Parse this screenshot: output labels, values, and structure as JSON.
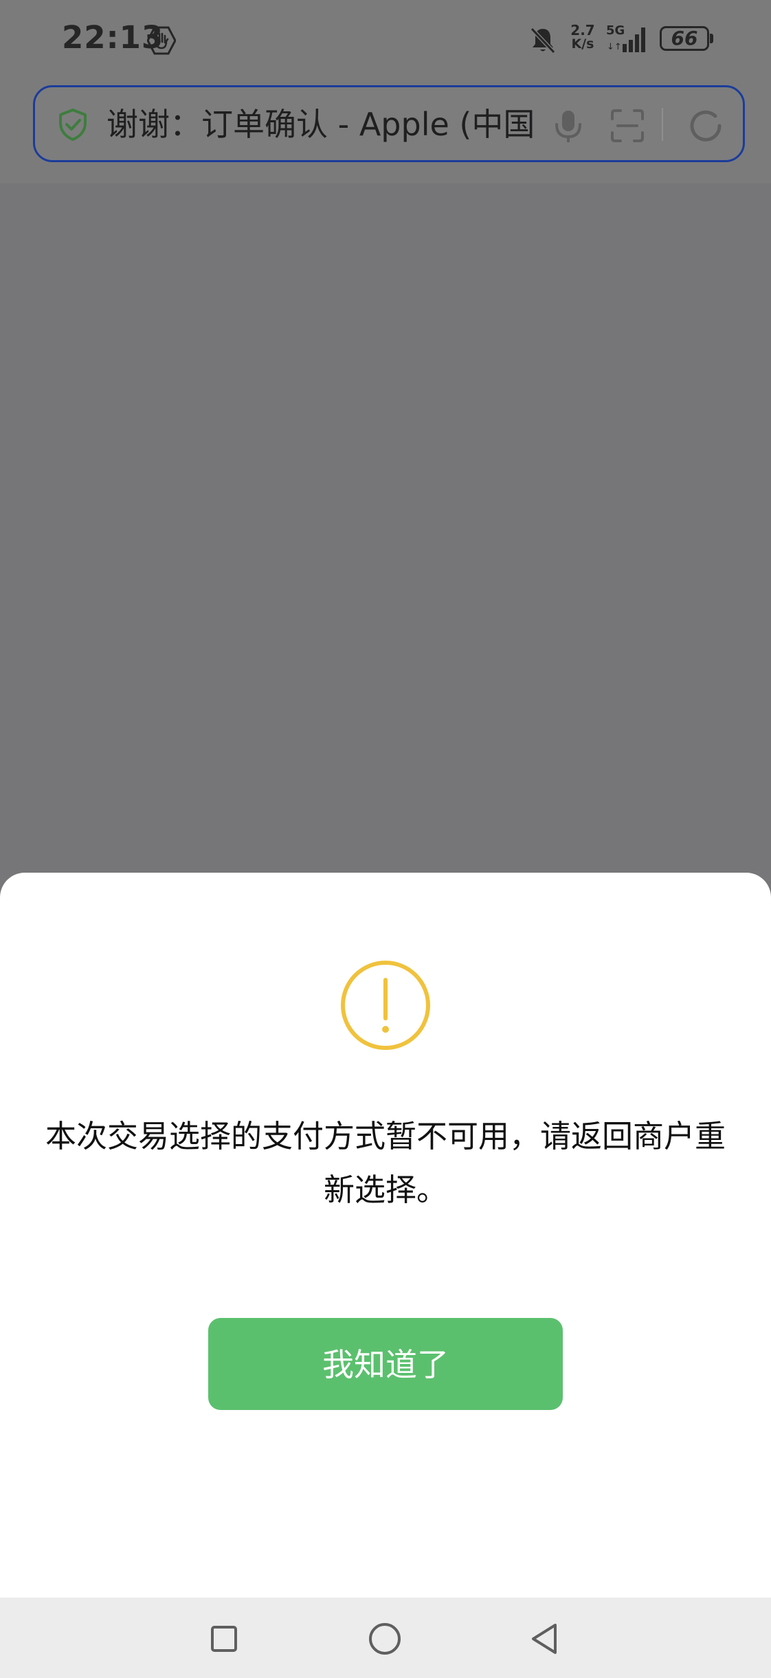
{
  "status_bar": {
    "time": "22:13",
    "net_speed_value": "2.7",
    "net_speed_unit": "K/s",
    "network_type": "5G",
    "battery_level": "66",
    "icons": [
      "hand-icon",
      "bell-off-icon",
      "signal-icon",
      "battery-icon"
    ]
  },
  "address_bar": {
    "title": "谢谢：订单确认 - Apple (中国",
    "icons": [
      "shield-icon",
      "mic-icon",
      "scan-icon",
      "refresh-icon"
    ],
    "border_color": "#1c3c9a",
    "shield_color": "#3e7d3e"
  },
  "dialog": {
    "icon": "warning-icon",
    "icon_color": "#f0c23d",
    "message": "本次交易选择的支付方式暂不可用，请返回商户重新选择。",
    "button_label": "我知道了",
    "button_color": "#5bc06e"
  },
  "nav_bar": {
    "icons": [
      "recent-apps-icon",
      "home-icon",
      "back-icon"
    ]
  }
}
